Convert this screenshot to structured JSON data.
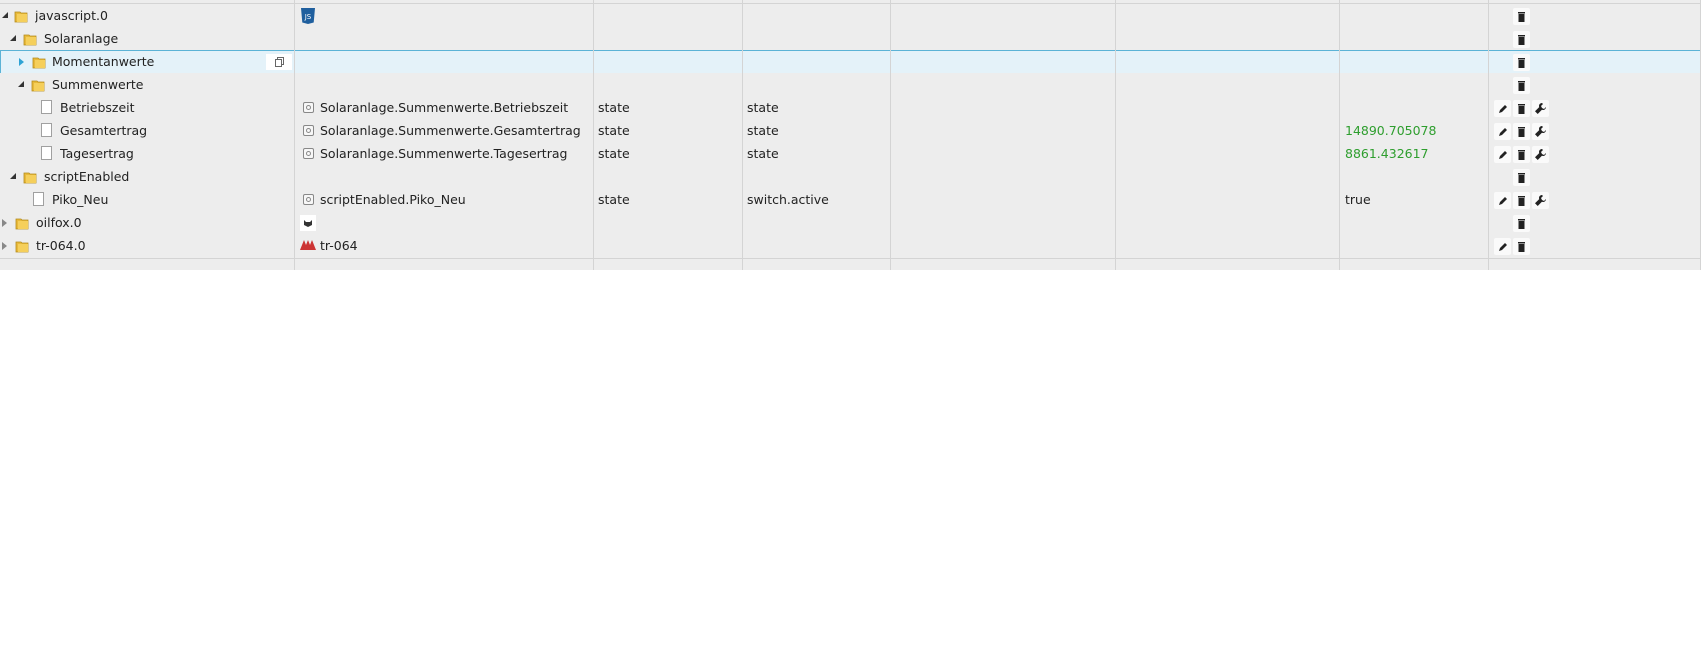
{
  "rows": [
    {
      "name": "javascript.0",
      "id": "",
      "type": "",
      "role": "",
      "value": ""
    },
    {
      "name": "Solaranlage",
      "id": "",
      "type": "",
      "role": "",
      "value": ""
    },
    {
      "name": "Momentanwerte",
      "id": "",
      "type": "",
      "role": "",
      "value": ""
    },
    {
      "name": "Summenwerte",
      "id": "",
      "type": "",
      "role": "",
      "value": ""
    },
    {
      "name": "Betriebszeit",
      "id": "Solaranlage.Summenwerte.Betriebszeit",
      "type": "state",
      "role": "state",
      "value": ""
    },
    {
      "name": "Gesamtertrag",
      "id": "Solaranlage.Summenwerte.Gesamtertrag",
      "type": "state",
      "role": "state",
      "value": "14890.705078"
    },
    {
      "name": "Tagesertrag",
      "id": "Solaranlage.Summenwerte.Tagesertrag",
      "type": "state",
      "role": "state",
      "value": "8861.432617"
    },
    {
      "name": "scriptEnabled",
      "id": "",
      "type": "",
      "role": "",
      "value": ""
    },
    {
      "name": "Piko_Neu",
      "id": "scriptEnabled.Piko_Neu",
      "type": "state",
      "role": "switch.active",
      "value": "true"
    },
    {
      "name": "oilfox.0",
      "id": "",
      "type": "",
      "role": "",
      "value": ""
    },
    {
      "name": "tr-064.0",
      "id": "tr-064",
      "type": "",
      "role": "",
      "value": ""
    }
  ],
  "icons": {
    "js_logo": "JS",
    "edit": "pencil-icon",
    "delete": "trash-icon",
    "settings": "wrench-icon",
    "copy": "copy-icon"
  },
  "colors": {
    "value_green": "#2e9e2e",
    "selection_border": "#5bb3d6",
    "js_blue": "#1f5f9e"
  }
}
